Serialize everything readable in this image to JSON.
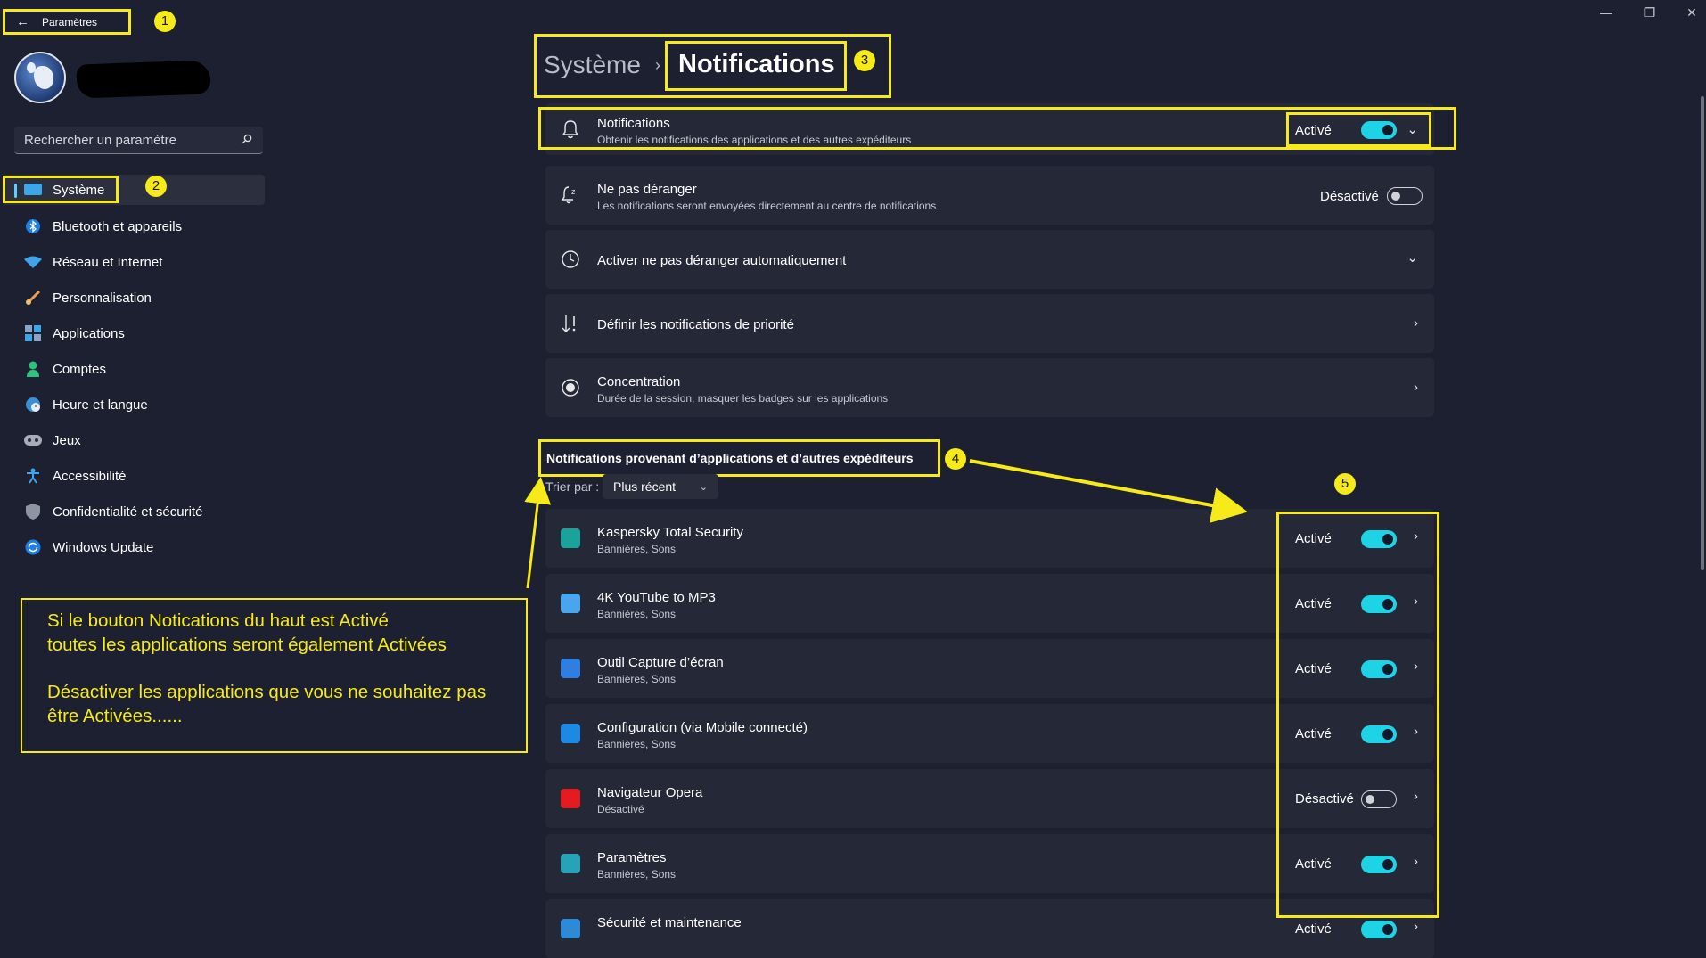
{
  "window": {
    "minimize": "—",
    "maximize": "❐",
    "close": "✕"
  },
  "back": {
    "arrow": "←",
    "title": "Paramètres"
  },
  "callouts": [
    "1",
    "2",
    "3",
    "4",
    "5"
  ],
  "search": {
    "placeholder": "Rechercher un paramètre",
    "icon": "search-icon"
  },
  "sidebar": {
    "items": [
      {
        "label": "Système",
        "icon": "monitor-icon",
        "active": true
      },
      {
        "label": "Bluetooth et appareils",
        "icon": "bluetooth-icon"
      },
      {
        "label": "Réseau et Internet",
        "icon": "wifi-icon"
      },
      {
        "label": "Personnalisation",
        "icon": "brush-icon"
      },
      {
        "label": "Applications",
        "icon": "apps-icon"
      },
      {
        "label": "Comptes",
        "icon": "person-icon"
      },
      {
        "label": "Heure et langue",
        "icon": "globe-clock-icon"
      },
      {
        "label": "Jeux",
        "icon": "gamepad-icon"
      },
      {
        "label": "Accessibilité",
        "icon": "accessibility-icon"
      },
      {
        "label": "Confidentialité et sécurité",
        "icon": "shield-icon"
      },
      {
        "label": "Windows Update",
        "icon": "update-icon"
      }
    ]
  },
  "breadcrumb": {
    "parent": "Système",
    "separator": "›",
    "current": "Notifications"
  },
  "notifications": {
    "title": "Notifications",
    "subtitle": "Obtenir les notifications des applications et des autres expéditeurs",
    "state": "Activé",
    "on": true
  },
  "dnd": {
    "title": "Ne pas déranger",
    "subtitle": "Les notifications seront envoyées directement au centre de notifications",
    "state": "Désactivé",
    "on": false
  },
  "auto_dnd": {
    "title": "Activer ne pas déranger automatiquement"
  },
  "priority": {
    "title": "Définir les notifications de priorité"
  },
  "focus": {
    "title": "Concentration",
    "subtitle": "Durée de la session, masquer les badges sur les applications"
  },
  "section": {
    "title": "Notifications provenant d’applications et d’autres expéditeurs",
    "sort_label": "Trier par :",
    "sort_value": "Plus récent"
  },
  "apps": [
    {
      "name": "Kaspersky Total Security",
      "detail": "Bannières, Sons",
      "state": "Activé",
      "on": true,
      "color": "#1aa39a"
    },
    {
      "name": "4K YouTube to MP3",
      "detail": "Bannières, Sons",
      "state": "Activé",
      "on": true,
      "color": "#4aa5ef"
    },
    {
      "name": "Outil Capture d’écran",
      "detail": "Bannières, Sons",
      "state": "Activé",
      "on": true,
      "color": "#2f7fe0"
    },
    {
      "name": "Configuration (via Mobile connecté)",
      "detail": "Bannières, Sons",
      "state": "Activé",
      "on": true,
      "color": "#1e88e5"
    },
    {
      "name": "Navigateur Opera",
      "detail": "Désactivé",
      "state": "Désactivé",
      "on": false,
      "color": "#e41b23"
    },
    {
      "name": "Paramètres",
      "detail": "Bannières, Sons",
      "state": "Activé",
      "on": true,
      "color": "#27a3b8"
    },
    {
      "name": "Sécurité et maintenance",
      "detail": "",
      "state": "Activé",
      "on": true,
      "color": "#2e89d6"
    }
  ],
  "note": {
    "line1": "Si le bouton Notications du haut est Activé",
    "line2": "toutes les applications seront également Activées",
    "line3": "Désactiver les applications que vous ne souhaitez pas",
    "line4": "être Activées......"
  },
  "colors": {
    "highlight": "#f6ea1a",
    "toggle_on": "#1fd3e6",
    "background": "#1c2030",
    "card": "#252937"
  }
}
